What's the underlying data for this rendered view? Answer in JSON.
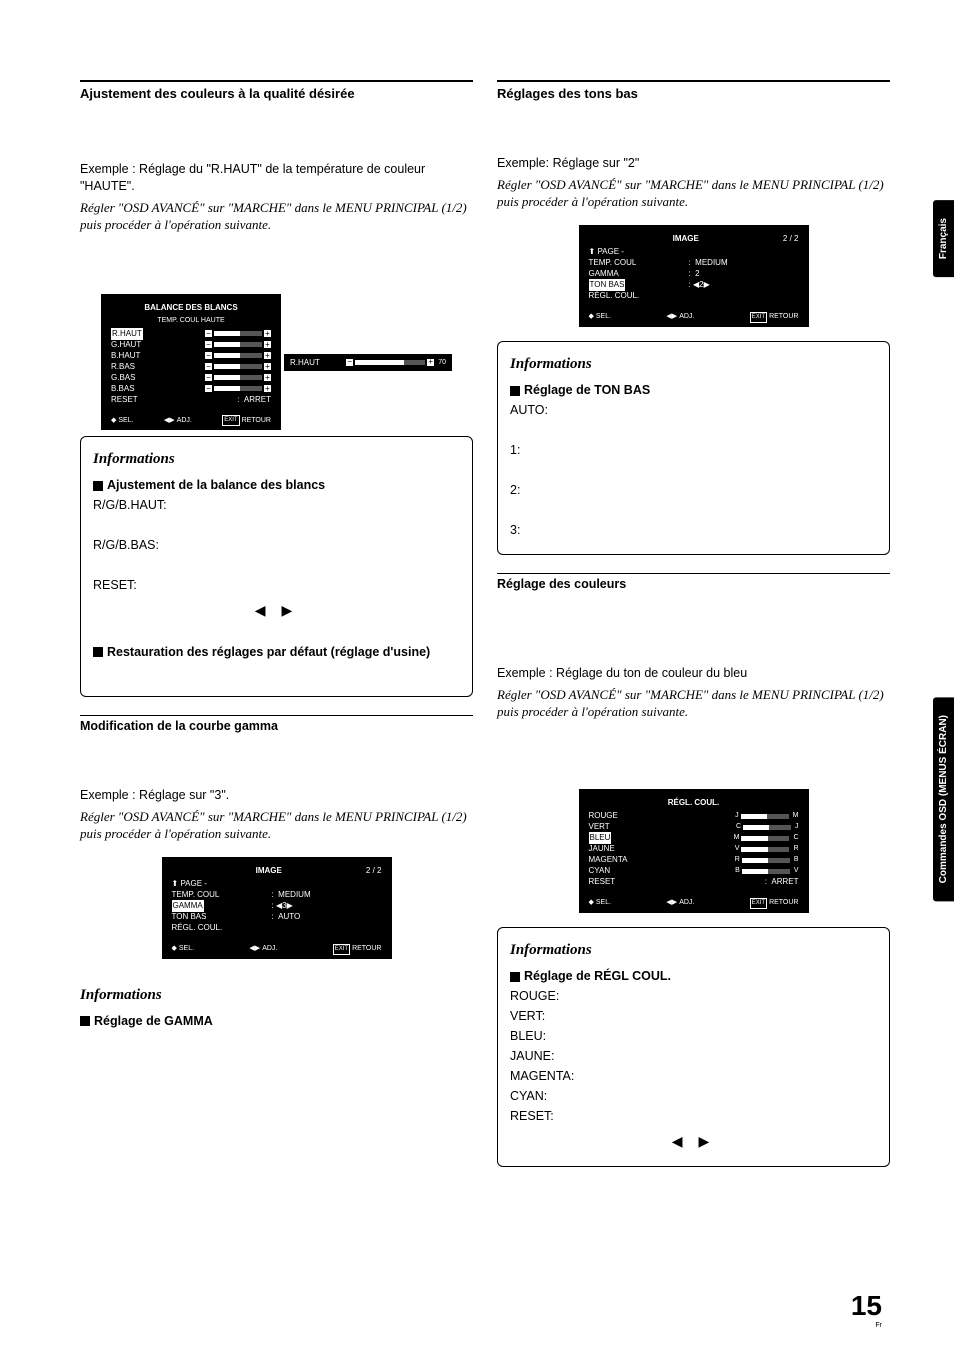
{
  "left": {
    "h1": "Ajustement des couleurs à la qualité désirée",
    "p1a": "Exemple : Réglage du \"R.HAUT\" de la température de couleur \"HAUTE\".",
    "p1b": "Régler \"OSD AVANCÉ\" sur \"MARCHE\" dans le MENU PRINCIPAL (1/2) puis procéder à l'opération suivante.",
    "osd1": {
      "title": "BALANCE DES BLANCS",
      "sub": "TEMP. COUL HAUTE",
      "rows": [
        "R.HAUT",
        "G.HAUT",
        "B.HAUT",
        "R.BAS",
        "G.BAS",
        "B.BAS",
        "RESET"
      ],
      "reset_val": "ARRET",
      "detail_label": "R.HAUT",
      "detail_val": "70",
      "f_sel": "SEL.",
      "f_adj": "ADJ.",
      "f_exit": "EXIT",
      "f_ret": "RETOUR"
    },
    "info1": {
      "title": "Informations",
      "h1": "Ajustement de la balance des blancs",
      "l1": "R/G/B.HAUT:",
      "l2": "R/G/B.BAS:",
      "l3": "RESET:",
      "h2": "Restauration des réglages par défaut (réglage d'usine)"
    },
    "h2": "Modification de la courbe gamma",
    "p2a": "Exemple : Réglage sur \"3\".",
    "p2b": "Régler \"OSD AVANCÉ\" sur \"MARCHE\" dans le MENU PRINCIPAL (1/2) puis procéder à l'opération suivante.",
    "osd2": {
      "title": "IMAGE",
      "page": "2 / 2",
      "page_up": "PAGE -",
      "rows": [
        {
          "k": "TEMP. COUL",
          "v": "MEDIUM"
        },
        {
          "k": "GAMMA",
          "v": "3",
          "hl": true,
          "arrows": true
        },
        {
          "k": "TON BAS",
          "v": "AUTO"
        },
        {
          "k": "RÉGL. COUL.",
          "v": ""
        }
      ],
      "f_sel": "SEL.",
      "f_adj": "ADJ.",
      "f_exit": "EXIT",
      "f_ret": "RETOUR"
    },
    "info2": {
      "title": "Informations",
      "h": "Réglage de GAMMA"
    }
  },
  "right": {
    "h1": "Réglages des tons bas",
    "p1a": "Exemple: Réglage sur \"2\"",
    "p1b": "Régler \"OSD AVANCÉ\" sur \"MARCHE\" dans le MENU PRINCIPAL (1/2) puis procéder à l'opération suivante.",
    "osd1": {
      "title": "IMAGE",
      "page": "2 / 2",
      "page_up": "PAGE -",
      "rows": [
        {
          "k": "TEMP. COUL",
          "v": "MEDIUM"
        },
        {
          "k": "GAMMA",
          "v": "2"
        },
        {
          "k": "TON BAS",
          "v": "2",
          "hl": true,
          "arrows": true
        },
        {
          "k": "RÉGL. COUL.",
          "v": ""
        }
      ],
      "f_sel": "SEL.",
      "f_adj": "ADJ.",
      "f_exit": "EXIT",
      "f_ret": "RETOUR"
    },
    "info1": {
      "title": "Informations",
      "h": "Réglage de TON BAS",
      "l0": "AUTO:",
      "l1": "1:",
      "l2": "2:",
      "l3": "3:"
    },
    "h2": "Réglage des couleurs",
    "p2a": "Exemple : Réglage du ton de couleur du bleu",
    "p2b": "Régler \"OSD AVANCÉ\" sur \"MARCHE\" dans le MENU PRINCIPAL (1/2) puis procéder à l'opération suivante.",
    "osd2": {
      "title": "RÉGL. COUL.",
      "rows": [
        {
          "k": "ROUGE",
          "l": "J",
          "r": "M"
        },
        {
          "k": "VERT",
          "l": "C",
          "r": "J"
        },
        {
          "k": "BLEU",
          "l": "M",
          "r": "C",
          "hl": true
        },
        {
          "k": "JAUNE",
          "l": "V",
          "r": "R"
        },
        {
          "k": "MAGENTA",
          "l": "R",
          "r": "B"
        },
        {
          "k": "CYAN",
          "l": "B",
          "r": "V"
        },
        {
          "k": "RESET",
          "v": "ARRET"
        }
      ],
      "f_sel": "SEL.",
      "f_adj": "ADJ.",
      "f_exit": "EXIT",
      "f_ret": "RETOUR"
    },
    "info2": {
      "title": "Informations",
      "h": "Réglage de RÉGL COUL.",
      "rows": [
        "ROUGE:",
        "VERT:",
        "BLEU:",
        "JAUNE:",
        "MAGENTA:",
        "CYAN:",
        "RESET:"
      ]
    }
  },
  "tabs": {
    "t1": "Français",
    "t2": "Commandes OSD (MENUS ÉCRAN)"
  },
  "pagenum": "15",
  "pagelang": "Fr"
}
